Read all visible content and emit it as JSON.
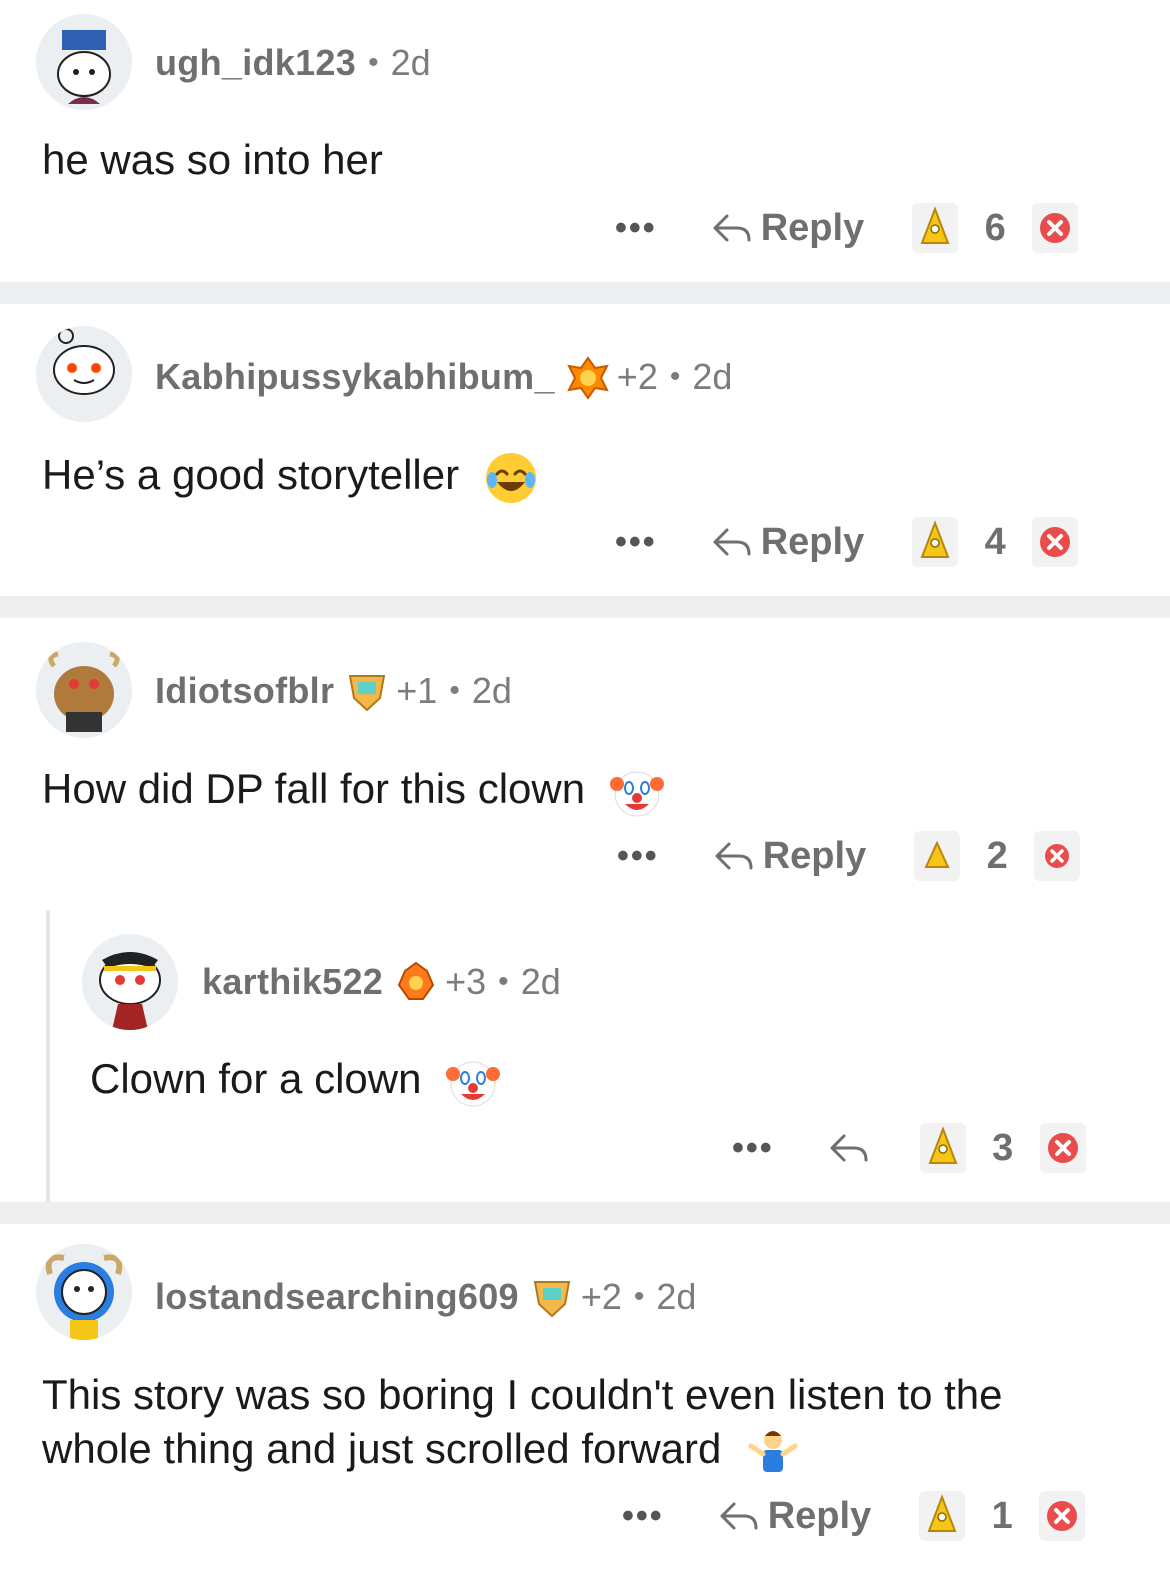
{
  "comments": [
    {
      "username": "ugh_idk123",
      "flair_count": "",
      "age": "2d",
      "text": "he was so into her",
      "emoji": "",
      "reply_label": "Reply",
      "score": "6"
    },
    {
      "username": "Kabhipussykabhibum_",
      "flair_count": "+2",
      "age": "2d",
      "text": "He’s a good storyteller",
      "emoji": "joy-emoji",
      "reply_label": "Reply",
      "score": "4"
    },
    {
      "username": "Idiotsofblr",
      "flair_count": "+1",
      "age": "2d",
      "text": "How did DP fall for this clown",
      "emoji": "clown-emoji",
      "reply_label": "Reply",
      "score": "2"
    },
    {
      "username": "karthik522",
      "flair_count": "+3",
      "age": "2d",
      "text": "Clown for a clown",
      "emoji": "clown-emoji",
      "reply_label": "",
      "score": "3"
    },
    {
      "username": "lostandsearching609",
      "flair_count": "+2",
      "age": "2d",
      "text_line1": "This story was so boring I couldn't even listen to the",
      "text_line2": "whole thing and just scrolled forward",
      "emoji": "shrug-emoji",
      "reply_label": "Reply",
      "score": "1"
    }
  ],
  "more_label": "•••",
  "dot": "•",
  "colors": {
    "meta": "#7c7c7c",
    "divider": "#edeff1",
    "upvote": "#f5c518",
    "downvote": "#ea4c4c"
  }
}
